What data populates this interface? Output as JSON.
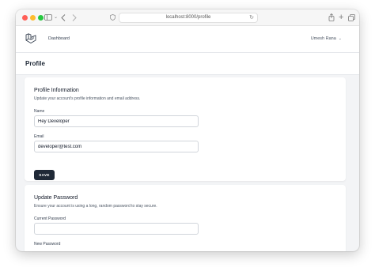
{
  "browser": {
    "url": "localhost:8000/profile"
  },
  "nav": {
    "links": [
      "Dashboard"
    ],
    "user_name": "Umesh Rana"
  },
  "page": {
    "title": "Profile"
  },
  "profile_info": {
    "title": "Profile Information",
    "description": "Update your account's profile information and email address.",
    "name_label": "Name",
    "name_value": "Hey Developer",
    "email_label": "Email",
    "email_value": "developer@test.com",
    "save_label": "SAVE"
  },
  "password": {
    "title": "Update Password",
    "description": "Ensure your account is using a long, random password to stay secure.",
    "current_label": "Current Password",
    "current_value": "",
    "new_label": "New Password"
  },
  "colors": {
    "button_bg": "#1f2937",
    "logo": "#374151"
  },
  "icons": [
    "sidebar-icon",
    "back-icon",
    "forward-icon",
    "shield-icon",
    "reload-icon",
    "share-icon",
    "plus-icon",
    "tabs-icon",
    "laravel-logo",
    "chevron-down-icon"
  ]
}
